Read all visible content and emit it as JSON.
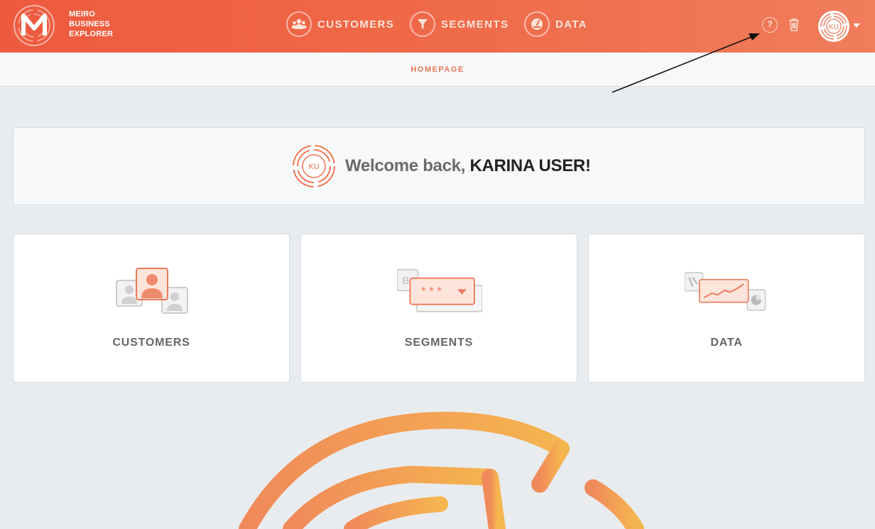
{
  "brand": {
    "line1": "MEIRO",
    "line2": "BUSINESS",
    "line3": "EXPLORER"
  },
  "nav": {
    "customers": {
      "label": "CUSTOMERS",
      "icon": "users-icon"
    },
    "segments": {
      "label": "SEGMENTS",
      "icon": "funnel-icon"
    },
    "data": {
      "label": "DATA",
      "icon": "gauge-icon"
    }
  },
  "header": {
    "help": "?",
    "user_initials": "KU"
  },
  "breadcrumb": {
    "label": "HOMEPAGE"
  },
  "welcome": {
    "greeting": "Welcome back,",
    "user_name": "KARINA USER!",
    "initials": "KU"
  },
  "tiles": [
    {
      "label": "CUSTOMERS"
    },
    {
      "label": "SEGMENTS",
      "sample": "* * *"
    },
    {
      "label": "DATA"
    }
  ],
  "colors": {
    "accent": "#ee5a3e",
    "accent_light": "#f07d5c",
    "tile_text": "#666666",
    "background": "#e9ecef"
  }
}
